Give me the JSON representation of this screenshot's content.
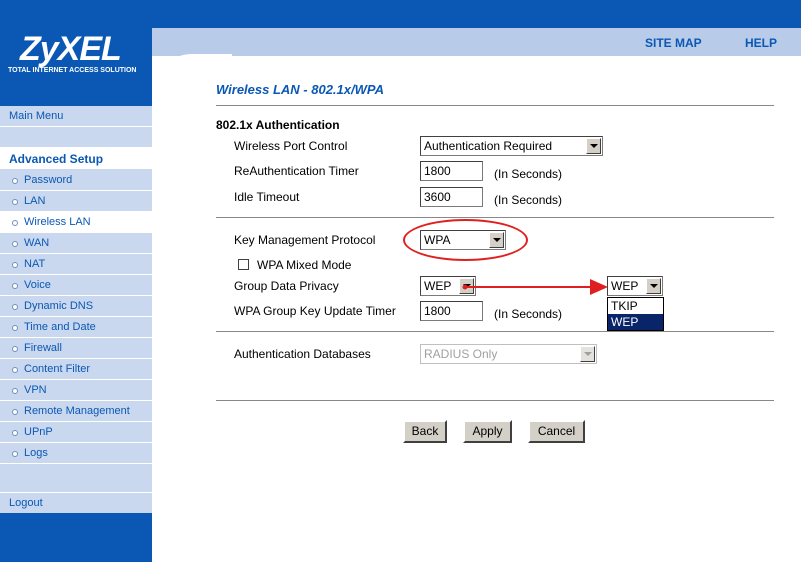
{
  "header": {
    "brand": "ZyXEL",
    "tagline": "TOTAL INTERNET ACCESS SOLUTION",
    "site_map": "SITE MAP",
    "help": "HELP"
  },
  "sidebar": {
    "main_menu": "Main Menu",
    "section_label": "Advanced Setup",
    "items": [
      {
        "label": "Password"
      },
      {
        "label": "LAN"
      },
      {
        "label": "Wireless LAN"
      },
      {
        "label": "WAN"
      },
      {
        "label": "NAT"
      },
      {
        "label": "Voice"
      },
      {
        "label": "Dynamic DNS"
      },
      {
        "label": "Time and Date"
      },
      {
        "label": "Firewall"
      },
      {
        "label": "Content Filter"
      },
      {
        "label": "VPN"
      },
      {
        "label": "Remote Management"
      },
      {
        "label": "UPnP"
      },
      {
        "label": "Logs"
      }
    ],
    "active_item": "Wireless LAN",
    "logout": "Logout"
  },
  "page": {
    "title": "Wireless LAN - 802.1x/WPA"
  },
  "auth": {
    "heading": "802.1x Authentication",
    "port_control_label": "Wireless Port Control",
    "port_control_value": "Authentication Required",
    "reauth_label": "ReAuthentication Timer",
    "reauth_value": "1800",
    "reauth_unit": "(In Seconds)",
    "idle_label": "Idle Timeout",
    "idle_value": "3600",
    "idle_unit": "(In Seconds)"
  },
  "keymgmt": {
    "protocol_label": "Key Management Protocol",
    "protocol_value": "WPA",
    "mixed_label": "WPA Mixed Mode",
    "mixed_checked": false,
    "privacy_label": "Group Data Privacy",
    "privacy_value": "WEP",
    "privacy_zoom_value": "WEP",
    "privacy_options": [
      "TKIP",
      "WEP"
    ],
    "privacy_highlighted": "WEP",
    "group_key_label": "WPA Group Key Update Timer",
    "group_key_value": "1800",
    "group_key_unit": "(In Seconds)"
  },
  "database": {
    "label": "Authentication Databases",
    "value": "RADIUS Only"
  },
  "buttons": {
    "back": "Back",
    "apply": "Apply",
    "cancel": "Cancel"
  },
  "annotation": {
    "highlight_color": "#e02020",
    "arrow_color": "#e02020"
  }
}
